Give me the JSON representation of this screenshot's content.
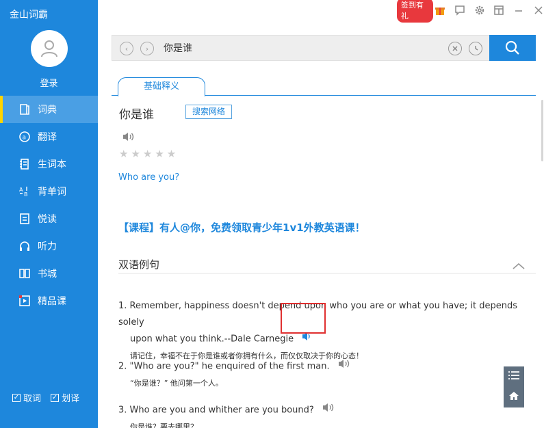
{
  "app": {
    "title": "金山词霸",
    "login": "登录"
  },
  "nav": [
    {
      "label": "词典",
      "icon": "book-icon"
    },
    {
      "label": "翻译",
      "icon": "translate-icon"
    },
    {
      "label": "生词本",
      "icon": "notebook-icon"
    },
    {
      "label": "背单词",
      "icon": "memorize-icon"
    },
    {
      "label": "悦读",
      "icon": "reading-icon"
    },
    {
      "label": "听力",
      "icon": "headphones-icon"
    },
    {
      "label": "书城",
      "icon": "bookstore-icon"
    },
    {
      "label": "精品课",
      "icon": "course-icon"
    }
  ],
  "bottom": {
    "cancel_label": "取词",
    "select_label": "划译"
  },
  "topbar": {
    "sign_badge": "签到有礼"
  },
  "search": {
    "value": "你是谁"
  },
  "tabs": {
    "basic": "基础释义"
  },
  "entry": {
    "word": "你是谁",
    "web_search": "搜索网络",
    "translation": "Who are you?",
    "stars_filled": 0,
    "stars_total": 5
  },
  "promo": "【课程】有人@你，免费领取青少年1v1外教英语课！",
  "section": {
    "title": "双语例句"
  },
  "examples": [
    {
      "num": "1.",
      "en_line1": "Remember, happiness doesn't depend upon who you are or what you have; it depends solely",
      "en_line2": "upon what you think.--Dale Carnegie",
      "cn": "请记住，幸福不在于你是谁或者你拥有什么，而仅仅取决于你的心态！"
    },
    {
      "num": "2.",
      "en_line1": "\"Who are you?\" he enquired of the first man.",
      "cn": "“你是谁？” 他问第一个人。"
    },
    {
      "num": "3.",
      "en_line1": "Who are you and whither are you bound?",
      "cn": "你是谁？要去哪里？"
    }
  ],
  "colors": {
    "sidebar": "#1e87dc",
    "active": "#4a9fe4",
    "accent": "#1e87dc",
    "badge": "#e8383d",
    "highlight": "#e03030"
  }
}
